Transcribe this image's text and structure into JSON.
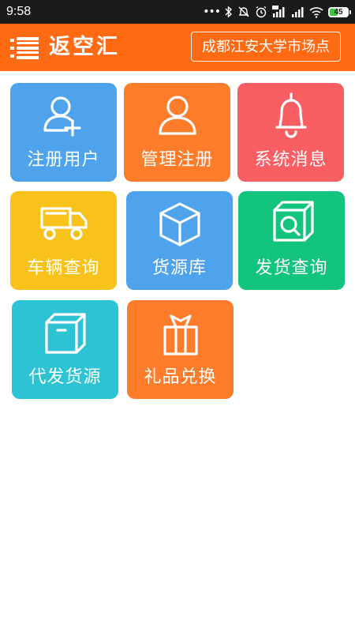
{
  "status_bar": {
    "time": "9:58",
    "battery_level": "45",
    "battery_percent": 45,
    "icons": [
      "dots-icon",
      "bluetooth-icon",
      "alarm-off-icon",
      "clock-icon",
      "hd-signal-icon",
      "signal-icon",
      "wifi-icon",
      "battery-icon"
    ]
  },
  "header": {
    "title": "返空汇",
    "location": "成都江安大学市场点",
    "background_color": "#ff6a13"
  },
  "tiles": [
    {
      "label": "注册用户",
      "icon": "add-user-icon",
      "color": "#4fa3ec"
    },
    {
      "label": "管理注册",
      "icon": "user-icon",
      "color": "#ff7c2a"
    },
    {
      "label": "系统消息",
      "icon": "bell-icon",
      "color": "#f95e63"
    },
    {
      "label": "车辆查询",
      "icon": "truck-icon",
      "color": "#f9c21b"
    },
    {
      "label": "货源库",
      "icon": "box-icon",
      "color": "#4fa3ec"
    },
    {
      "label": "发货查询",
      "icon": "box-search-icon",
      "color": "#12c47d"
    },
    {
      "label": "代发货源",
      "icon": "package-icon",
      "color": "#2cc3d4"
    },
    {
      "label": "礼品兑换",
      "icon": "gift-icon",
      "color": "#ff7c2a"
    }
  ]
}
